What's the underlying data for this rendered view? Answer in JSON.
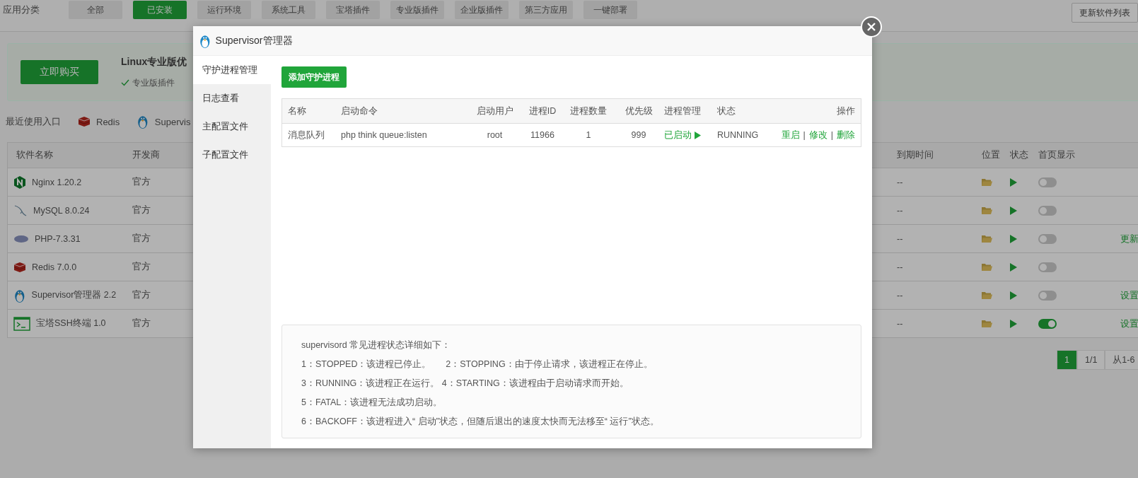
{
  "page": {
    "category_label": "应用分类",
    "categories": [
      {
        "label": "全部",
        "selected": false
      },
      {
        "label": "已安装",
        "selected": true
      },
      {
        "label": "运行环境",
        "selected": false
      },
      {
        "label": "系统工具",
        "selected": false
      },
      {
        "label": "宝塔插件",
        "selected": false
      },
      {
        "label": "专业版插件",
        "selected": false
      },
      {
        "label": "企业版插件",
        "selected": false
      },
      {
        "label": "第三方应用",
        "selected": false
      },
      {
        "label": "一键部署",
        "selected": false
      }
    ],
    "update_button": "更新软件列表",
    "promo": {
      "buy_button": "立即购买",
      "title": "Linux专业版优",
      "feature": "专业版插件"
    },
    "recent": {
      "label": "最近使用入口",
      "items": [
        "Redis",
        "Supervis"
      ]
    },
    "table": {
      "columns": [
        "软件名称",
        "开发商",
        "到期时间",
        "位置",
        "状态",
        "首页显示"
      ],
      "rows": [
        {
          "name": "Nginx 1.20.2",
          "developer": "官方",
          "expiry": "--",
          "home": false
        },
        {
          "name": "MySQL 8.0.24",
          "developer": "官方",
          "expiry": "--",
          "home": false
        },
        {
          "name": "PHP-7.3.31",
          "developer": "官方",
          "expiry": "--",
          "home": false,
          "action": "更新"
        },
        {
          "name": "Redis 7.0.0",
          "developer": "官方",
          "expiry": "--",
          "home": false
        },
        {
          "name": "Supervisor管理器 2.2",
          "developer": "官方",
          "expiry": "--",
          "home": false,
          "action": "设置"
        },
        {
          "name": "宝塔SSH终端 1.0",
          "developer": "官方",
          "expiry": "--",
          "home": true,
          "action": "设置"
        }
      ]
    },
    "pagination": [
      {
        "label": "1",
        "selected": true
      },
      {
        "label": "1/1",
        "selected": false
      },
      {
        "label": "从1-6",
        "selected": false
      }
    ]
  },
  "dialog": {
    "title": "Supervisor管理器",
    "menu": [
      {
        "label": "守护进程管理",
        "selected": true
      },
      {
        "label": "日志查看",
        "selected": false
      },
      {
        "label": "主配置文件",
        "selected": false
      },
      {
        "label": "子配置文件",
        "selected": false
      }
    ],
    "add_button": "添加守护进程",
    "columns": [
      "名称",
      "启动命令",
      "启动用户",
      "进程ID",
      "进程数量",
      "优先级",
      "进程管理",
      "状态",
      "操作"
    ],
    "rows": [
      {
        "name": "消息队列",
        "command": "php think queue:listen",
        "user": "root",
        "pid": "11966",
        "count": "1",
        "priority": "999",
        "manage": "已启动",
        "started": true,
        "status": "RUNNING",
        "actions": [
          "重启",
          "修改",
          "删除"
        ],
        "separator": "|"
      }
    ],
    "notes": [
      "supervisord 常见进程状态详细如下：",
      "1：STOPPED：该进程已停止。      2：STOPPING：由于停止请求，该进程正在停止。",
      "3：RUNNING：该进程正在运行。 4：STARTING：该进程由于启动请求而开始。",
      "5：FATAL：该进程无法成功启动。",
      "6：BACKOFF：该进程进入“ 启动”状态，但随后退出的速度太快而无法移至“ 运行”状态。"
    ]
  }
}
